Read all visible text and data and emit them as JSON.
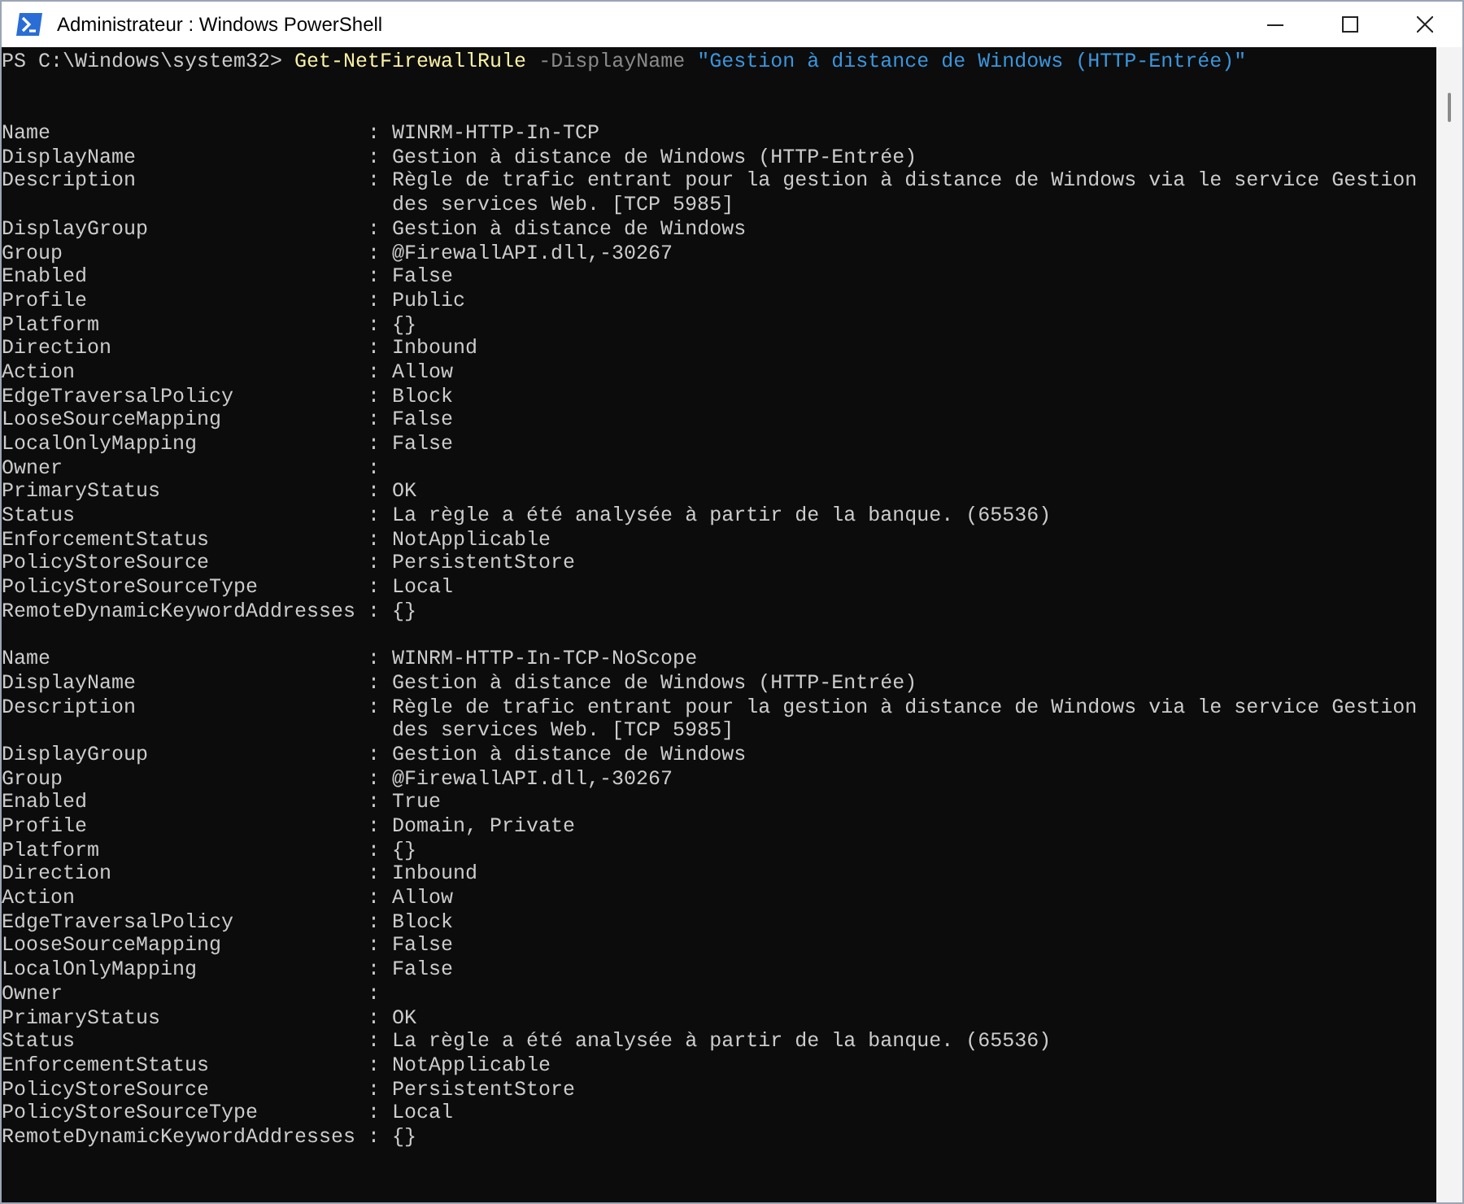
{
  "window": {
    "title": "Administrateur : Windows PowerShell"
  },
  "command": {
    "prompt": "PS C:\\Windows\\system32>",
    "cmdlet": "Get-NetFirewallRule",
    "parameter": "-DisplayName",
    "argument": "\"Gestion à distance de Windows (HTTP-Entrée)\""
  },
  "records": [
    {
      "properties": [
        {
          "name": "Name",
          "lines": [
            ": WINRM-HTTP-In-TCP"
          ]
        },
        {
          "name": "DisplayName",
          "lines": [
            ": Gestion à distance de Windows (HTTP-Entrée)"
          ]
        },
        {
          "name": "Description",
          "lines": [
            ": Règle de trafic entrant pour la gestion à distance de Windows via le service Gestion",
            "des services Web. [TCP 5985]"
          ]
        },
        {
          "name": "DisplayGroup",
          "lines": [
            ": Gestion à distance de Windows"
          ]
        },
        {
          "name": "Group",
          "lines": [
            ": @FirewallAPI.dll,-30267"
          ]
        },
        {
          "name": "Enabled",
          "lines": [
            ": False"
          ]
        },
        {
          "name": "Profile",
          "lines": [
            ": Public"
          ]
        },
        {
          "name": "Platform",
          "lines": [
            ": {}"
          ]
        },
        {
          "name": "Direction",
          "lines": [
            ": Inbound"
          ]
        },
        {
          "name": "Action",
          "lines": [
            ": Allow"
          ]
        },
        {
          "name": "EdgeTraversalPolicy",
          "lines": [
            ": Block"
          ]
        },
        {
          "name": "LooseSourceMapping",
          "lines": [
            ": False"
          ]
        },
        {
          "name": "LocalOnlyMapping",
          "lines": [
            ": False"
          ]
        },
        {
          "name": "Owner",
          "lines": [
            ":"
          ]
        },
        {
          "name": "PrimaryStatus",
          "lines": [
            ": OK"
          ]
        },
        {
          "name": "Status",
          "lines": [
            ": La règle a été analysée à partir de la banque. (65536)"
          ]
        },
        {
          "name": "EnforcementStatus",
          "lines": [
            ": NotApplicable"
          ]
        },
        {
          "name": "PolicyStoreSource",
          "lines": [
            ": PersistentStore"
          ]
        },
        {
          "name": "PolicyStoreSourceType",
          "lines": [
            ": Local"
          ]
        },
        {
          "name": "RemoteDynamicKeywordAddresses",
          "lines": [
            ": {}"
          ]
        }
      ]
    },
    {
      "properties": [
        {
          "name": "Name",
          "lines": [
            ": WINRM-HTTP-In-TCP-NoScope"
          ]
        },
        {
          "name": "DisplayName",
          "lines": [
            ": Gestion à distance de Windows (HTTP-Entrée)"
          ]
        },
        {
          "name": "Description",
          "lines": [
            ": Règle de trafic entrant pour la gestion à distance de Windows via le service Gestion",
            "des services Web. [TCP 5985]"
          ]
        },
        {
          "name": "DisplayGroup",
          "lines": [
            ": Gestion à distance de Windows"
          ]
        },
        {
          "name": "Group",
          "lines": [
            ": @FirewallAPI.dll,-30267"
          ]
        },
        {
          "name": "Enabled",
          "lines": [
            ": True"
          ]
        },
        {
          "name": "Profile",
          "lines": [
            ": Domain, Private"
          ]
        },
        {
          "name": "Platform",
          "lines": [
            ": {}"
          ]
        },
        {
          "name": "Direction",
          "lines": [
            ": Inbound"
          ]
        },
        {
          "name": "Action",
          "lines": [
            ": Allow"
          ]
        },
        {
          "name": "EdgeTraversalPolicy",
          "lines": [
            ": Block"
          ]
        },
        {
          "name": "LooseSourceMapping",
          "lines": [
            ": False"
          ]
        },
        {
          "name": "LocalOnlyMapping",
          "lines": [
            ": False"
          ]
        },
        {
          "name": "Owner",
          "lines": [
            ":"
          ]
        },
        {
          "name": "PrimaryStatus",
          "lines": [
            ": OK"
          ]
        },
        {
          "name": "Status",
          "lines": [
            ": La règle a été analysée à partir de la banque. (65536)"
          ]
        },
        {
          "name": "EnforcementStatus",
          "lines": [
            ": NotApplicable"
          ]
        },
        {
          "name": "PolicyStoreSource",
          "lines": [
            ": PersistentStore"
          ]
        },
        {
          "name": "PolicyStoreSourceType",
          "lines": [
            ": Local"
          ]
        },
        {
          "name": "RemoteDynamicKeywordAddresses",
          "lines": [
            ": {}"
          ]
        }
      ]
    }
  ]
}
